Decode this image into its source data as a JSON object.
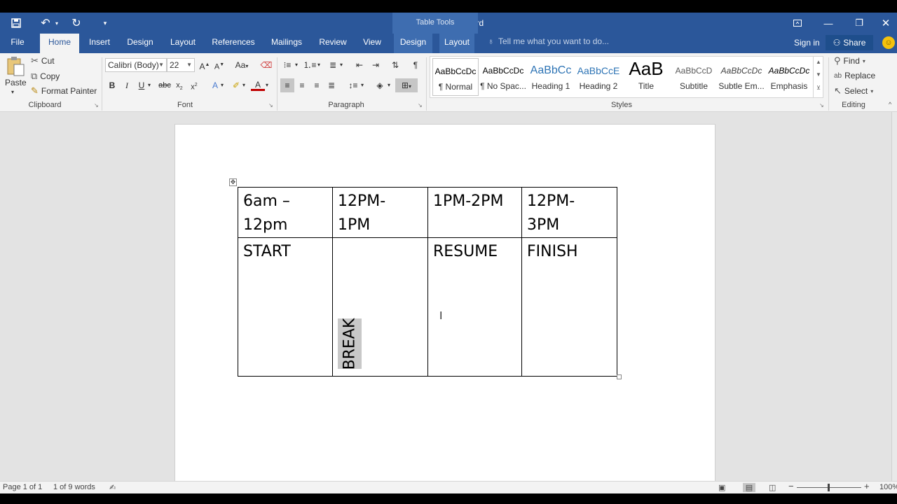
{
  "title_bar": {
    "title": "Document3 - Word",
    "table_tools": "Table Tools"
  },
  "tabs": [
    "File",
    "Home",
    "Insert",
    "Design",
    "Layout",
    "References",
    "Mailings",
    "Review",
    "View",
    "Design",
    "Layout"
  ],
  "active_tab": "Home",
  "tell_me": "Tell me what you want to do...",
  "account": {
    "sign_in": "Sign in",
    "share": "Share"
  },
  "clipboard": {
    "paste": "Paste",
    "cut": "Cut",
    "copy": "Copy",
    "format_painter": "Format Painter",
    "label": "Clipboard"
  },
  "font": {
    "name": "Calibri (Body)",
    "size": "22",
    "label": "Font",
    "change_case": "Aa"
  },
  "paragraph": {
    "label": "Paragraph"
  },
  "styles": {
    "label": "Styles",
    "items": [
      {
        "preview": "AaBbCcDc",
        "name": "¶ Normal"
      },
      {
        "preview": "AaBbCcDc",
        "name": "¶ No Spac..."
      },
      {
        "preview": "AaBbCc",
        "name": "Heading 1"
      },
      {
        "preview": "AaBbCcE",
        "name": "Heading 2"
      },
      {
        "preview": "AaB",
        "name": "Title"
      },
      {
        "preview": "AaBbCcD",
        "name": "Subtitle"
      },
      {
        "preview": "AaBbCcDc",
        "name": "Subtle Em..."
      },
      {
        "preview": "AaBbCcDc",
        "name": "Emphasis"
      }
    ]
  },
  "editing": {
    "label": "Editing",
    "find": "Find",
    "replace": "Replace",
    "select": "Select"
  },
  "table": {
    "headers": [
      "6am –\n12pm",
      "12PM-\n1PM",
      "1PM-2PM",
      "12PM-\n3PM"
    ],
    "row": [
      "START",
      "",
      "RESUME",
      "FINISH"
    ],
    "vertical_text": "BREAK"
  },
  "status": {
    "page": "Page 1 of 1",
    "words": "1 of 9 words",
    "zoom": "100%"
  },
  "colors": {
    "word_blue": "#2b579a",
    "ribbon_bg": "#f3f3f3",
    "doc_bg": "#e3e3e3"
  }
}
